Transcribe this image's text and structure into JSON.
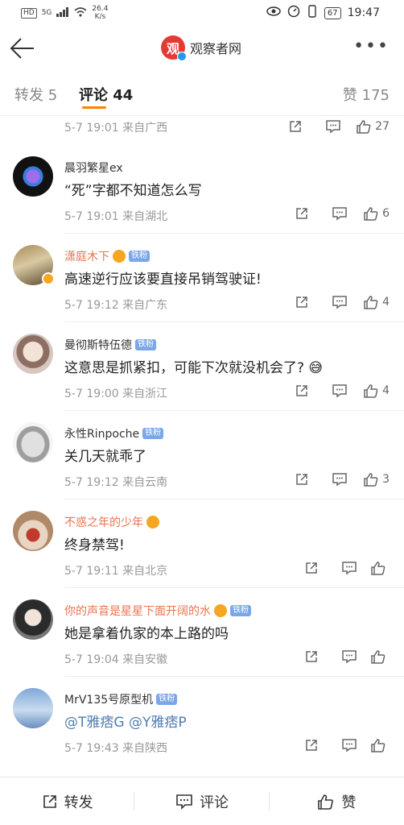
{
  "status_bar": {
    "left_badge": "HD",
    "signal": "5G",
    "speed_value": "26.4",
    "speed_unit": "K/s",
    "battery": "67",
    "time": "19:47"
  },
  "nav": {
    "title": "观察者网"
  },
  "tabs": {
    "repost": "转发 5",
    "comment": "评论 44",
    "like": "赞 175"
  },
  "partial_row": {
    "meta": "5-7 19:01  来自广西",
    "likes": "27"
  },
  "comments": [
    {
      "name": "晨羽繁星ex",
      "vip": false,
      "badge": "",
      "crown": false,
      "text": "“死”字都不知道怎么写",
      "meta": "5-7 19:01  来自湖北",
      "likes": "6",
      "link": false
    },
    {
      "name": "潇庭木下",
      "vip": true,
      "badge": "铁粉",
      "crown": true,
      "text": "高速逆行应该要直接吊销驾驶证!",
      "meta": "5-7 19:12  来自广东",
      "likes": "4",
      "link": false
    },
    {
      "name": "曼彻斯特伍德",
      "vip": false,
      "badge": "铁粉",
      "crown": false,
      "text": "这意思是抓紧扣，可能下次就没机会了? 😅",
      "meta": "5-7 19:00  来自浙江",
      "likes": "4",
      "link": false
    },
    {
      "name": "永性Rinpoche",
      "vip": false,
      "badge": "铁粉",
      "crown": false,
      "text": "关几天就乖了",
      "meta": "5-7 19:12  来自云南",
      "likes": "3",
      "link": false
    },
    {
      "name": "不惑之年的少年",
      "vip": true,
      "badge": "",
      "crown": true,
      "text": "终身禁驾!",
      "meta": "5-7 19:11  来自北京",
      "likes": "",
      "link": false
    },
    {
      "name": "你的声音是星星下面开阔的水",
      "vip": true,
      "badge": "铁粉",
      "crown": true,
      "text": "她是拿着仇家的本上路的吗",
      "meta": "5-7 19:04  来自安徽",
      "likes": "",
      "link": false
    },
    {
      "name": "MrV135号原型机",
      "vip": false,
      "badge": "铁粉",
      "crown": false,
      "text": "@T雅痞G @Y雅痞P",
      "meta": "5-7 19:43  来自陕西",
      "likes": "",
      "link": true
    }
  ],
  "bottom_bar": {
    "repost": "转发",
    "comment": "评论",
    "like": "赞"
  },
  "colors": {
    "accent": "#ff8200",
    "vip_name": "#eb7350",
    "link": "#507daf",
    "fan_badge": "#7aa7e8"
  }
}
